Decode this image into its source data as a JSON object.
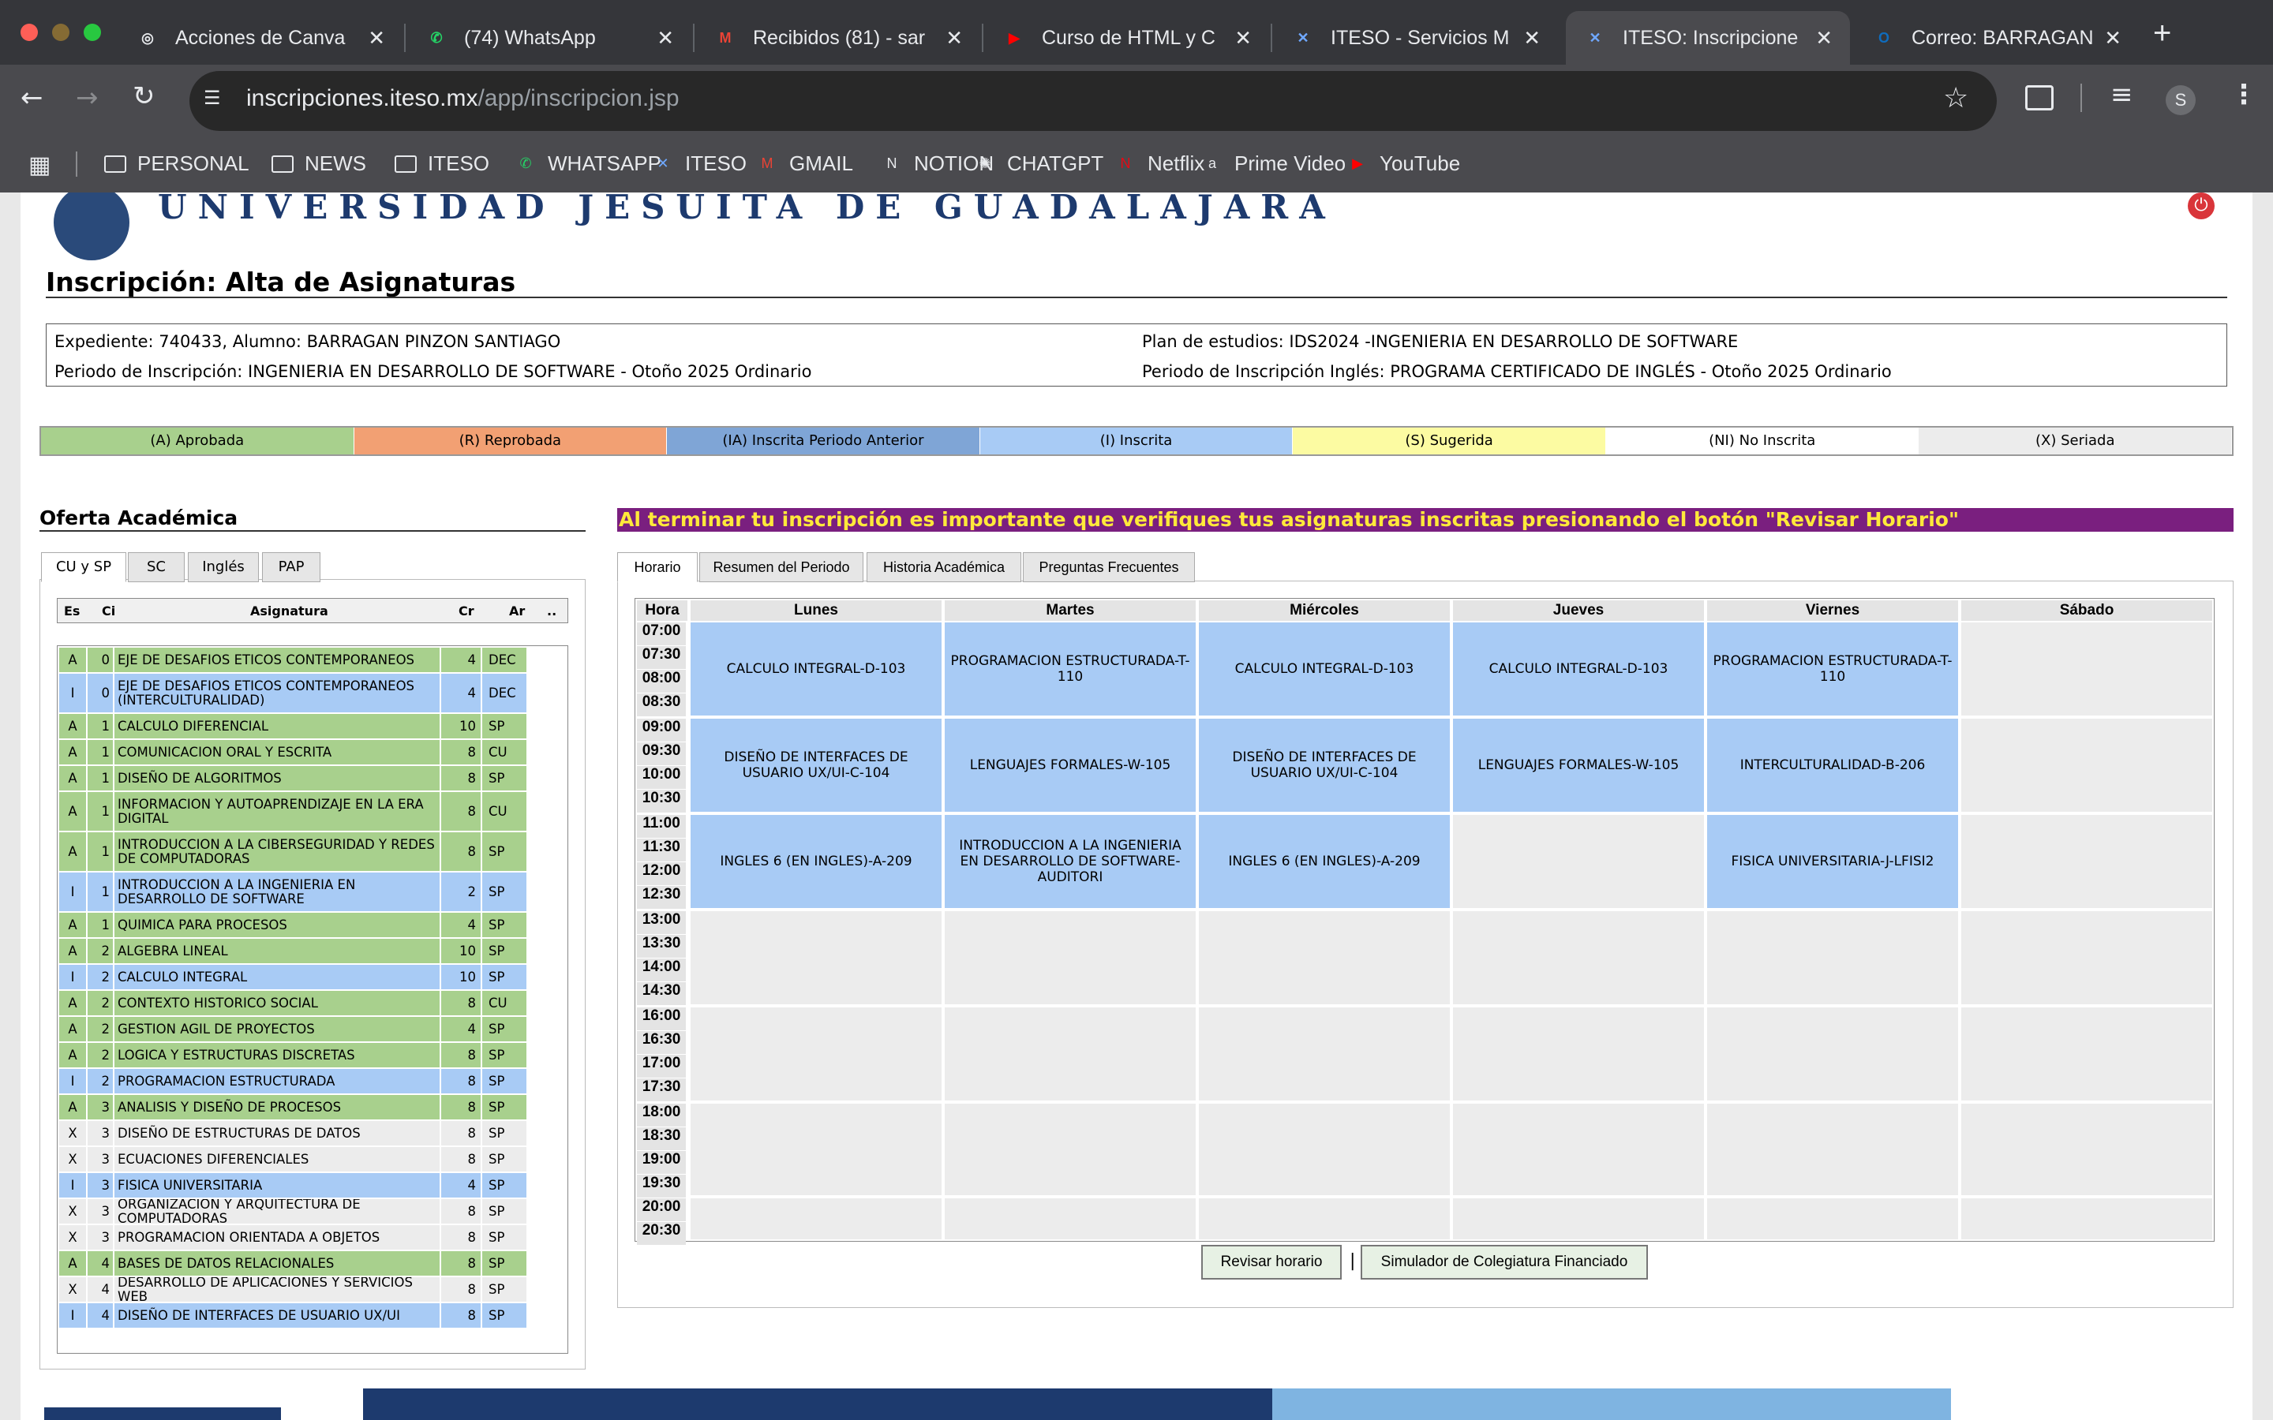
{
  "browser": {
    "tabs": [
      {
        "title": "Acciones de Canva",
        "icon": "canva-icon"
      },
      {
        "title": "(74) WhatsApp",
        "icon": "whatsapp-icon"
      },
      {
        "title": "Recibidos (81) - sar",
        "icon": "gmail-icon"
      },
      {
        "title": "Curso de HTML y C",
        "icon": "youtube-icon"
      },
      {
        "title": "ITESO - Servicios M",
        "icon": "iteso-icon"
      },
      {
        "title": "ITESO: Inscripcione",
        "icon": "iteso-icon"
      },
      {
        "title": "Correo: BARRAGAN",
        "icon": "outlook-icon"
      }
    ],
    "new_tab": "+",
    "url_domain": "inscripciones.iteso.mx",
    "url_path": "/app/inscripcion.jsp",
    "profile_initial": "S",
    "bookmarks": [
      {
        "label": "PERSONAL",
        "icon": "folder-icon"
      },
      {
        "label": "NEWS",
        "icon": "folder-icon"
      },
      {
        "label": "ITESO",
        "icon": "folder-icon"
      },
      {
        "label": "WHATSAPP",
        "icon": "whatsapp-icon"
      },
      {
        "label": "ITESO",
        "icon": "iteso-icon"
      },
      {
        "label": "GMAIL",
        "icon": "gmail-icon"
      },
      {
        "label": "NOTION",
        "icon": "notion-icon"
      },
      {
        "label": "CHATGPT",
        "icon": "chatgpt-icon"
      },
      {
        "label": "Netflix",
        "icon": "netflix-icon"
      },
      {
        "label": "Prime Video",
        "icon": "amazon-icon"
      },
      {
        "label": "YouTube",
        "icon": "youtube-icon"
      }
    ]
  },
  "header": {
    "university": "UNIVERSIDAD JESUITA DE GUADALAJARA",
    "page_title": "Inscripción: Alta de Asignaturas"
  },
  "info": {
    "expediente": "Expediente: 740433, Alumno: BARRAGAN PINZON SANTIAGO",
    "periodo": "Periodo de Inscripción: INGENIERIA EN DESARROLLO DE SOFTWARE - Otoño 2025 Ordinario",
    "plan": "Plan de estudios: IDS2024 -INGENIERIA EN DESARROLLO DE SOFTWARE",
    "periodo_ingles": "Periodo de Inscripción Inglés: PROGRAMA CERTIFICADO DE INGLÉS - Otoño 2025 Ordinario"
  },
  "legend": [
    {
      "label": "(A) Aprobada",
      "color": "#a8d08d"
    },
    {
      "label": "(R) Reprobada",
      "color": "#f2a073"
    },
    {
      "label": "(IA) Inscrita Periodo Anterior",
      "color": "#7fa5d6"
    },
    {
      "label": "(I) Inscrita",
      "color": "#a8cbf5"
    },
    {
      "label": "(S) Sugerida",
      "color": "#fcfba2"
    },
    {
      "label": "(NI) No Inscrita",
      "color": "#ffffff"
    },
    {
      "label": "(X) Seriada",
      "color": "#ececec"
    }
  ],
  "oferta": {
    "title": "Oferta Académica",
    "tabs": [
      "CU y SP",
      "SC",
      "Inglés",
      "PAP"
    ],
    "headers": {
      "es": "Es",
      "ci": "Ci",
      "asignatura": "Asignatura",
      "cr": "Cr",
      "ar": "Ar",
      "more": ".."
    },
    "rows": [
      {
        "es": "A",
        "ci": "0",
        "name": "EJE DE DESAFIOS ETICOS CONTEMPORANEOS",
        "cr": "4",
        "ar": "DEC"
      },
      {
        "es": "I",
        "ci": "0",
        "name": "EJE DE DESAFIOS ETICOS CONTEMPORANEOS (INTERCULTURALIDAD)",
        "cr": "4",
        "ar": "DEC"
      },
      {
        "es": "A",
        "ci": "1",
        "name": "CALCULO DIFERENCIAL",
        "cr": "10",
        "ar": "SP"
      },
      {
        "es": "A",
        "ci": "1",
        "name": "COMUNICACION ORAL Y ESCRITA",
        "cr": "8",
        "ar": "CU"
      },
      {
        "es": "A",
        "ci": "1",
        "name": "DISEÑO DE ALGORITMOS",
        "cr": "8",
        "ar": "SP"
      },
      {
        "es": "A",
        "ci": "1",
        "name": "INFORMACION Y AUTOAPRENDIZAJE EN LA ERA DIGITAL",
        "cr": "8",
        "ar": "CU"
      },
      {
        "es": "A",
        "ci": "1",
        "name": "INTRODUCCION A LA CIBERSEGURIDAD Y REDES DE COMPUTADORAS",
        "cr": "8",
        "ar": "SP"
      },
      {
        "es": "I",
        "ci": "1",
        "name": "INTRODUCCION A LA INGENIERIA EN DESARROLLO DE SOFTWARE",
        "cr": "2",
        "ar": "SP"
      },
      {
        "es": "A",
        "ci": "1",
        "name": "QUIMICA PARA PROCESOS",
        "cr": "4",
        "ar": "SP"
      },
      {
        "es": "A",
        "ci": "2",
        "name": "ALGEBRA LINEAL",
        "cr": "10",
        "ar": "SP"
      },
      {
        "es": "I",
        "ci": "2",
        "name": "CALCULO INTEGRAL",
        "cr": "10",
        "ar": "SP"
      },
      {
        "es": "A",
        "ci": "2",
        "name": "CONTEXTO HISTORICO SOCIAL",
        "cr": "8",
        "ar": "CU"
      },
      {
        "es": "A",
        "ci": "2",
        "name": "GESTION AGIL DE PROYECTOS",
        "cr": "4",
        "ar": "SP"
      },
      {
        "es": "A",
        "ci": "2",
        "name": "LOGICA Y ESTRUCTURAS DISCRETAS",
        "cr": "8",
        "ar": "SP"
      },
      {
        "es": "I",
        "ci": "2",
        "name": "PROGRAMACION ESTRUCTURADA",
        "cr": "8",
        "ar": "SP"
      },
      {
        "es": "A",
        "ci": "3",
        "name": "ANALISIS Y DISEÑO DE PROCESOS",
        "cr": "8",
        "ar": "SP"
      },
      {
        "es": "X",
        "ci": "3",
        "name": "DISEÑO DE ESTRUCTURAS DE DATOS",
        "cr": "8",
        "ar": "SP"
      },
      {
        "es": "X",
        "ci": "3",
        "name": "ECUACIONES DIFERENCIALES",
        "cr": "8",
        "ar": "SP"
      },
      {
        "es": "I",
        "ci": "3",
        "name": "FISICA UNIVERSITARIA",
        "cr": "4",
        "ar": "SP"
      },
      {
        "es": "X",
        "ci": "3",
        "name": "ORGANIZACION Y ARQUITECTURA DE COMPUTADORAS",
        "cr": "8",
        "ar": "SP"
      },
      {
        "es": "X",
        "ci": "3",
        "name": "PROGRAMACION ORIENTADA A OBJETOS",
        "cr": "8",
        "ar": "SP"
      },
      {
        "es": "A",
        "ci": "4",
        "name": "BASES DE DATOS RELACIONALES",
        "cr": "8",
        "ar": "SP"
      },
      {
        "es": "X",
        "ci": "4",
        "name": "DESARROLLO DE APLICACIONES Y SERVICIOS WEB",
        "cr": "8",
        "ar": "SP"
      },
      {
        "es": "I",
        "ci": "4",
        "name": "DISEÑO DE INTERFACES DE USUARIO UX/UI",
        "cr": "8",
        "ar": "SP"
      }
    ]
  },
  "notice": "Al terminar tu inscripción es importante que verifiques tus asignaturas inscritas presionando el botón \"Revisar Horario\"",
  "right_tabs": [
    "Horario",
    "Resumen del Periodo",
    "Historia Académica",
    "Preguntas Frecuentes"
  ],
  "schedule": {
    "hora_label": "Hora",
    "days": [
      "Lunes",
      "Martes",
      "Miércoles",
      "Jueves",
      "Viernes",
      "Sábado"
    ],
    "times": [
      "07:00",
      "07:30",
      "08:00",
      "08:30",
      "09:00",
      "09:30",
      "10:00",
      "10:30",
      "11:00",
      "11:30",
      "12:00",
      "12:30",
      "13:00",
      "13:30",
      "14:00",
      "14:30",
      "16:00",
      "16:30",
      "17:00",
      "17:30",
      "18:00",
      "18:30",
      "19:00",
      "19:30",
      "20:00",
      "20:30"
    ],
    "blocks": [
      [
        "CALCULO INTEGRAL-D-103",
        "PROGRAMACION ESTRUCTURADA-T-110",
        "CALCULO INTEGRAL-D-103",
        "CALCULO INTEGRAL-D-103",
        "PROGRAMACION ESTRUCTURADA-T-110",
        ""
      ],
      [
        "DISEÑO DE INTERFACES DE USUARIO UX/UI-C-104",
        "LENGUAJES FORMALES-W-105",
        "DISEÑO DE INTERFACES DE USUARIO UX/UI-C-104",
        "LENGUAJES FORMALES-W-105",
        "INTERCULTURALIDAD-B-206",
        ""
      ],
      [
        "INGLES 6 (EN INGLES)-A-209",
        "INTRODUCCION A LA INGENIERIA EN DESARROLLO DE SOFTWARE-AUDITORI",
        "INGLES 6 (EN INGLES)-A-209",
        "",
        "FISICA UNIVERSITARIA-J-LFISI2",
        ""
      ],
      [
        "",
        "",
        "",
        "",
        "",
        ""
      ],
      [
        "",
        "",
        "",
        "",
        "",
        ""
      ],
      [
        "",
        "",
        "",
        "",
        "",
        ""
      ],
      [
        "",
        "",
        "",
        "",
        "",
        ""
      ]
    ]
  },
  "buttons": {
    "revisar": "Revisar horario",
    "separator": "|",
    "simulador": "Simulador de Colegiatura Financiado"
  }
}
